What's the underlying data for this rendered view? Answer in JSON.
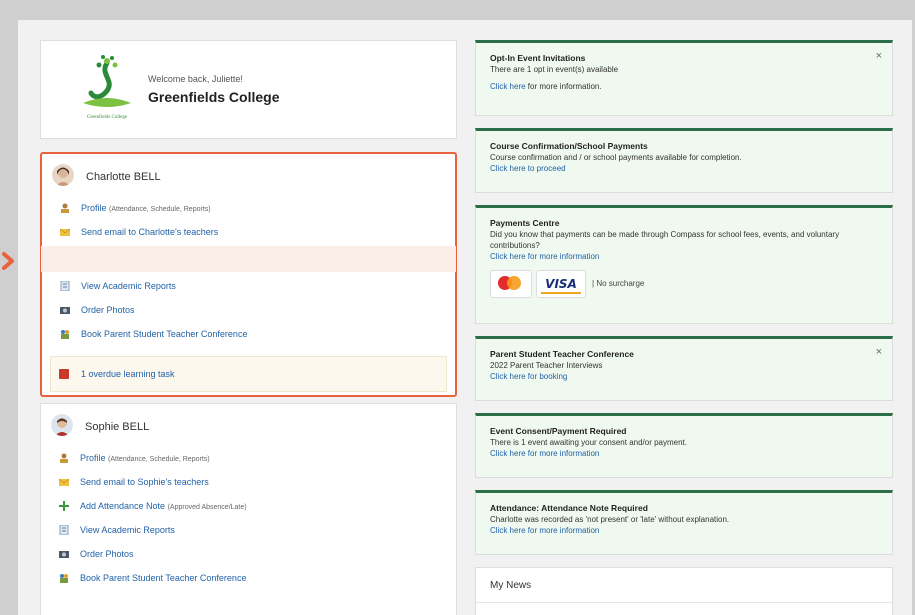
{
  "school": {
    "welcome": "Welcome back, Juliette!",
    "name": "Greenfields College",
    "logo_caption": "Greenfields College"
  },
  "students": [
    {
      "name": "Charlotte BELL",
      "links": [
        {
          "label": "Profile",
          "sub": "(Attendance, Schedule, Reports)",
          "icon": "profile-icon"
        },
        {
          "label": "Send email to Charlotte's teachers",
          "sub": "",
          "icon": "email-icon"
        },
        {
          "label": "View Academic Reports",
          "sub": "",
          "icon": "report-icon"
        },
        {
          "label": "Order Photos",
          "sub": "",
          "icon": "camera-icon"
        },
        {
          "label": "Book Parent Student Teacher Conference",
          "sub": "",
          "icon": "conference-icon"
        }
      ],
      "overdue": "1 overdue learning task"
    },
    {
      "name": "Sophie BELL",
      "links": [
        {
          "label": "Profile",
          "sub": "(Attendance, Schedule, Reports)",
          "icon": "profile-icon"
        },
        {
          "label": "Send email to Sophie's teachers",
          "sub": "",
          "icon": "email-icon"
        },
        {
          "label": "Add Attendance Note",
          "sub": "(Approved Absence/Late)",
          "icon": "plus-icon"
        },
        {
          "label": "View Academic Reports",
          "sub": "",
          "icon": "report-icon"
        },
        {
          "label": "Order Photos",
          "sub": "",
          "icon": "camera-icon"
        },
        {
          "label": "Book Parent Student Teacher Conference",
          "sub": "",
          "icon": "conference-icon"
        }
      ]
    }
  ],
  "notices": [
    {
      "title": "Opt-In Event Invitations",
      "body": "There are 1 opt in event(s) available",
      "link": "Click here",
      "tail": " for more information.",
      "closable": true
    },
    {
      "title": "Course Confirmation/School Payments",
      "body": "Course confirmation and / or school payments available for completion.",
      "link": "Click here to proceed",
      "tail": "",
      "closable": false
    },
    {
      "title": "Payments Centre",
      "body": "Did you know that payments can be made through Compass for school fees, events, and voluntary contributions?",
      "link": "Click here for more information",
      "tail": "",
      "closable": false,
      "visa": "VISA",
      "no_surcharge": "No surcharge"
    },
    {
      "title": "Parent Student Teacher Conference",
      "body": "2022 Parent Teacher Interviews",
      "link": "Click here for booking",
      "tail": "",
      "closable": true
    },
    {
      "title": "Event Consent/Payment Required",
      "body": "There is 1 event awaiting your consent and/or payment.",
      "link": "Click here for more information",
      "tail": "",
      "closable": false
    },
    {
      "title": "Attendance: Attendance Note Required",
      "body": "Charlotte was recorded as 'not present' or 'late' without explanation.",
      "link": "Click here for more information",
      "tail": "",
      "closable": false
    }
  ],
  "news": {
    "title": "My News"
  },
  "close_glyph": "×",
  "colors": {
    "accent": "#e8623e",
    "notice_border": "#2c6e47",
    "link": "#2262a8",
    "notice_bg": "#f0f9ef"
  }
}
